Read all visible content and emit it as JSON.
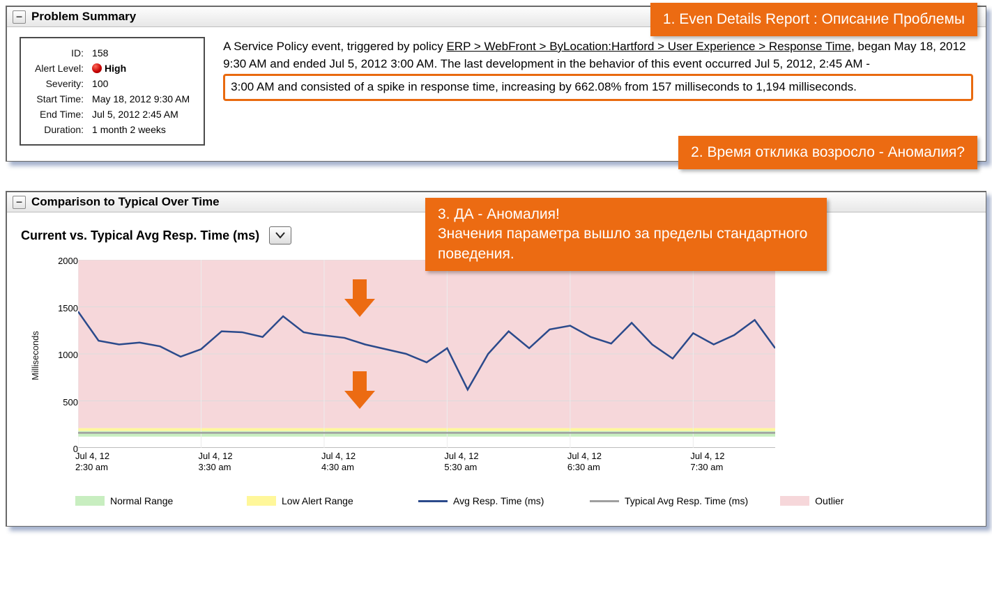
{
  "collapse_glyph": "–",
  "panel1": {
    "title": "Problem Summary",
    "info": {
      "id_label": "ID:",
      "id": "158",
      "alert_label": "Alert Level:",
      "alert": "High",
      "sev_label": "Severity:",
      "sev": "100",
      "start_label": "Start Time:",
      "start": "May 18, 2012 9:30 AM",
      "end_label": "End Time:",
      "end": "Jul 5, 2012 2:45 AM",
      "dur_label": "Duration:",
      "dur": "1 month 2 weeks"
    },
    "desc_pre": "A Service Policy event, triggered by policy ",
    "desc_link": "ERP > WebFront > ByLocation:Hartford > User Experience > Response Time",
    "desc_mid": ", began May 18, 2012 9:30 AM and ended Jul 5, 2012 3:00 AM. The last development in the behavior of this event occurred Jul 5, 2012, 2:45 AM - ",
    "desc_hl": "3:00 AM and consisted of a spike in response time, increasing by 662.08% from 157 milliseconds to 1,194 milliseconds."
  },
  "callouts": {
    "c1": "1. Even Details Report : Описание Проблемы",
    "c2": "2. Время отклика возросло -  Аномалия?",
    "c3a": "3. ДА - Аномалия!",
    "c3b": "Значения параметра вышло за пределы стандартного поведения."
  },
  "panel2": {
    "title": "Comparison to Typical Over Time",
    "chart_title": "Current vs. Typical Avg Resp. Time (ms)"
  },
  "legend": {
    "normal": "Normal Range",
    "low": "Low Alert Range",
    "avg": "Avg Resp. Time (ms)",
    "typical": "Typical Avg Resp. Time (ms)",
    "outlier": "Outlier"
  },
  "chart_data": {
    "type": "line",
    "title": "Current vs. Typical Avg Resp. Time (ms)",
    "xlabel": "",
    "ylabel": "Milliseconds",
    "ylim": [
      0,
      2000
    ],
    "yticks": [
      0,
      500,
      1000,
      1500,
      2000
    ],
    "x_tick_labels": [
      "Jul 4, 12\n2:30 am",
      "Jul 4, 12\n3:30 am",
      "Jul 4, 12\n4:30 am",
      "Jul 4, 12\n5:30 am",
      "Jul 4, 12\n6:30 am",
      "Jul 4, 12\n7:30 am"
    ],
    "series": [
      {
        "name": "Avg Resp. Time (ms)",
        "color": "#2b4a8b",
        "x_minutes_from_0230": [
          0,
          10,
          20,
          30,
          40,
          50,
          60,
          70,
          80,
          90,
          100,
          110,
          115,
          130,
          140,
          150,
          160,
          170,
          180,
          190,
          200,
          210,
          220,
          230,
          240,
          250,
          260,
          270,
          280,
          290,
          300,
          310,
          320,
          330,
          340
        ],
        "values": [
          1450,
          1140,
          1100,
          1120,
          1080,
          970,
          1050,
          1240,
          1230,
          1180,
          1400,
          1230,
          1210,
          1170,
          1100,
          1050,
          1000,
          910,
          1060,
          620,
          1000,
          1240,
          1060,
          1260,
          1300,
          1180,
          1110,
          1330,
          1100,
          950,
          1220,
          1100,
          1200,
          1360,
          1060
        ]
      },
      {
        "name": "Typical Avg Resp. Time (ms)",
        "color": "#9f9f9f",
        "x_minutes_from_0230": [
          0,
          340
        ],
        "values": [
          160,
          160
        ]
      }
    ],
    "bands": [
      {
        "name": "Outlier",
        "color": "#f6d7da",
        "y0": 210,
        "y1": 2000
      },
      {
        "name": "Low Alert Range",
        "color": "#fff79a",
        "y0": 180,
        "y1": 210
      },
      {
        "name": "Normal Range",
        "color": "#c8eec0",
        "y0": 120,
        "y1": 180
      }
    ],
    "legend_position": "bottom"
  }
}
